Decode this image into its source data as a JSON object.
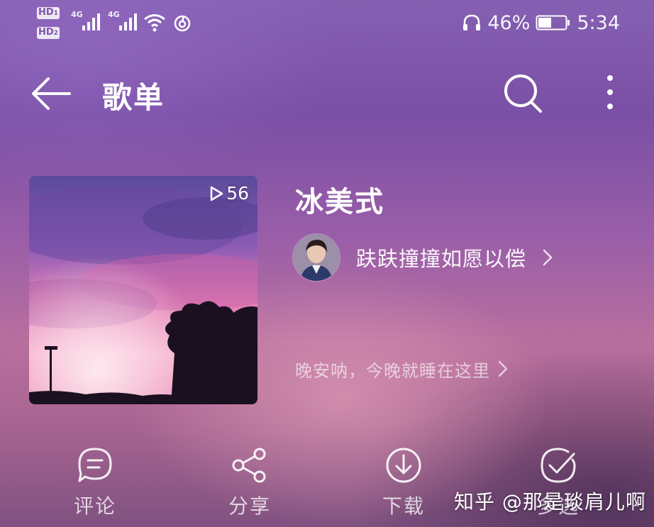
{
  "status_bar": {
    "sim1": "HD",
    "sim2": "HD",
    "network1": "4G",
    "network2": "4G",
    "battery": "46%",
    "time": "5:34",
    "icons": [
      "hd-icon",
      "signal-icon",
      "wifi-icon",
      "netease-icon",
      "headphones-icon",
      "battery-icon"
    ]
  },
  "header": {
    "title": "歌单"
  },
  "playlist": {
    "play_count": "56",
    "name": "冰美式",
    "creator": "趺趺撞撞如愿以偿",
    "description": "晚安呐，今晚就睡在这里"
  },
  "actions": [
    {
      "label": "评论",
      "icon": "comment-icon"
    },
    {
      "label": "分享",
      "icon": "share-icon"
    },
    {
      "label": "下载",
      "icon": "download-icon"
    },
    {
      "label": "多选",
      "icon": "multiselect-icon"
    }
  ],
  "watermark": "知乎 @那是琰肩儿啊",
  "colors": {
    "accent_purple": "#7d58a8",
    "background_pink": "#b86f9e"
  }
}
